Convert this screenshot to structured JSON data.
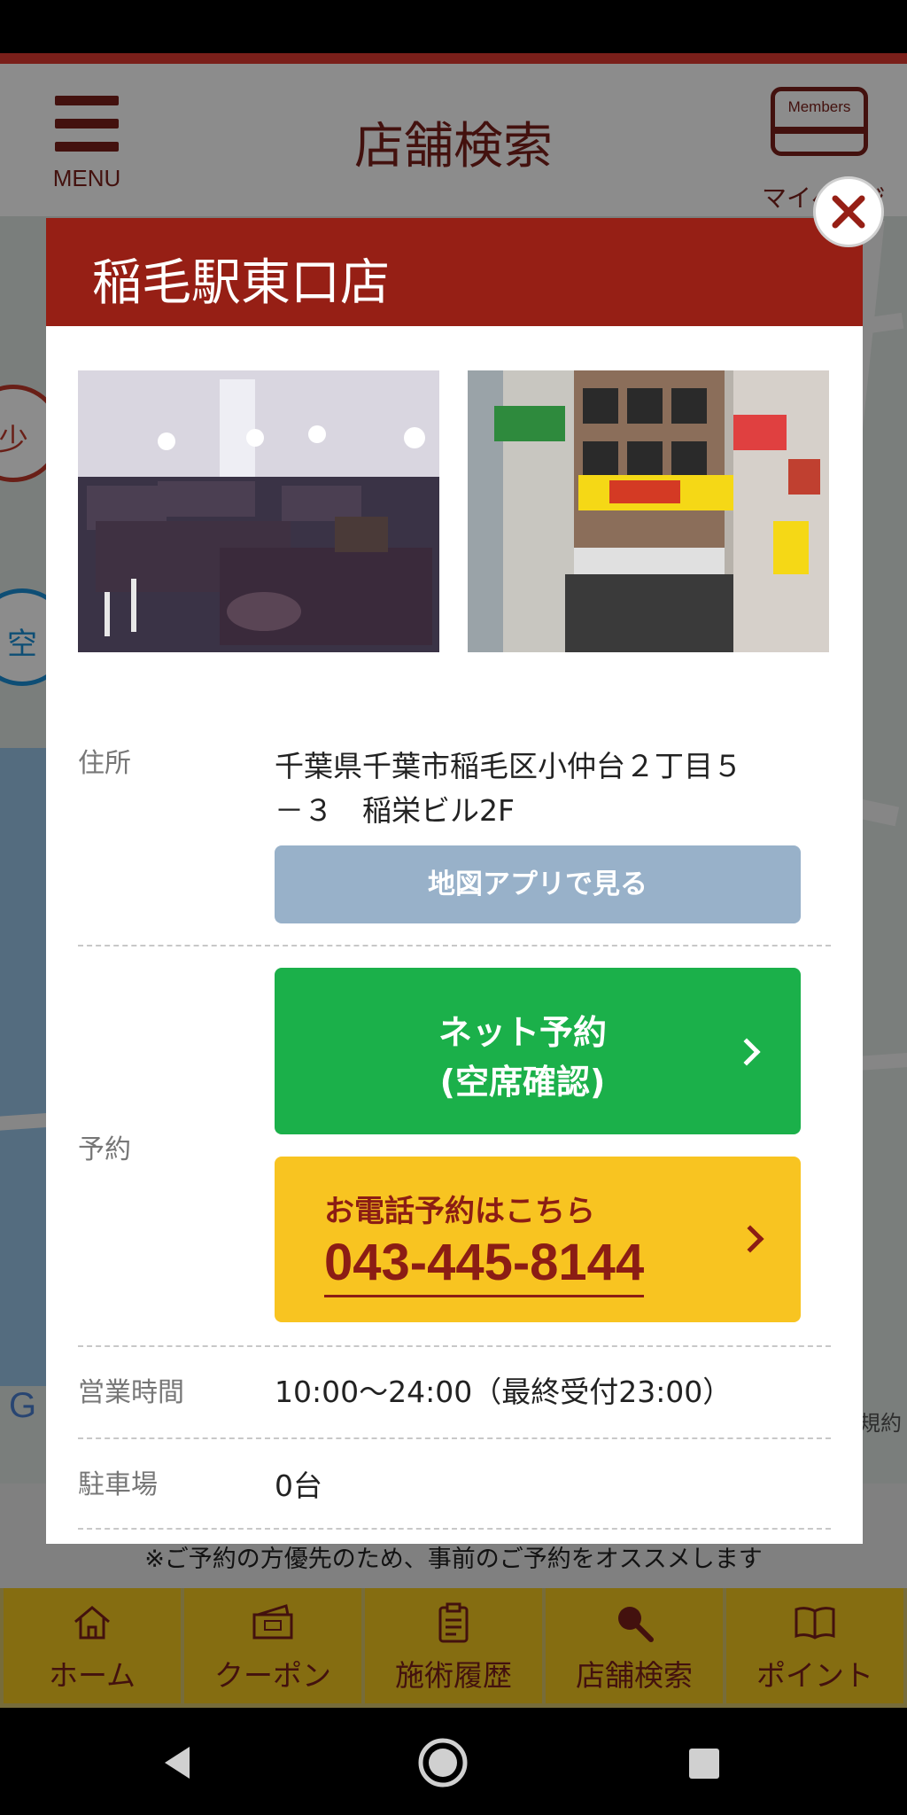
{
  "header": {
    "menu_label": "MENU",
    "title": "店舗検索",
    "members_card_label": "Members",
    "members_label": "マイページ"
  },
  "map": {
    "pin_1": "少",
    "pin_2": "空",
    "credit": "規約"
  },
  "modal": {
    "title": "稲毛駅東口店",
    "address": {
      "label": "住所",
      "line1": "千葉県千葉市稲毛区小仲台２丁目５",
      "line2": "－３　稲栄ビル2F",
      "map_button": "地図アプリで見る"
    },
    "reservation": {
      "label": "予約",
      "net_line1": "ネット予約",
      "net_line2": "(空席確認)",
      "tel_label": "お電話予約はこちら",
      "tel_number": "043-445-8144"
    },
    "hours": {
      "label": "営業時間",
      "value": "10:00～24:00（最終受付23:00）"
    },
    "parking": {
      "label": "駐車場",
      "value": "0台"
    }
  },
  "notice": "※ご予約の方優先のため、事前のご予約をオススメします",
  "bottom_nav": {
    "items": [
      {
        "label": "ホーム",
        "icon": "home-icon"
      },
      {
        "label": "クーポン",
        "icon": "coupon-icon"
      },
      {
        "label": "施術履歴",
        "icon": "clipboard-icon"
      },
      {
        "label": "店舗検索",
        "icon": "search-icon"
      },
      {
        "label": "ポイント",
        "icon": "book-icon"
      }
    ]
  },
  "colors": {
    "brand": "#961f15",
    "green": "#1bb04a",
    "yellow": "#f8c421",
    "map_button": "#98b1c9"
  }
}
